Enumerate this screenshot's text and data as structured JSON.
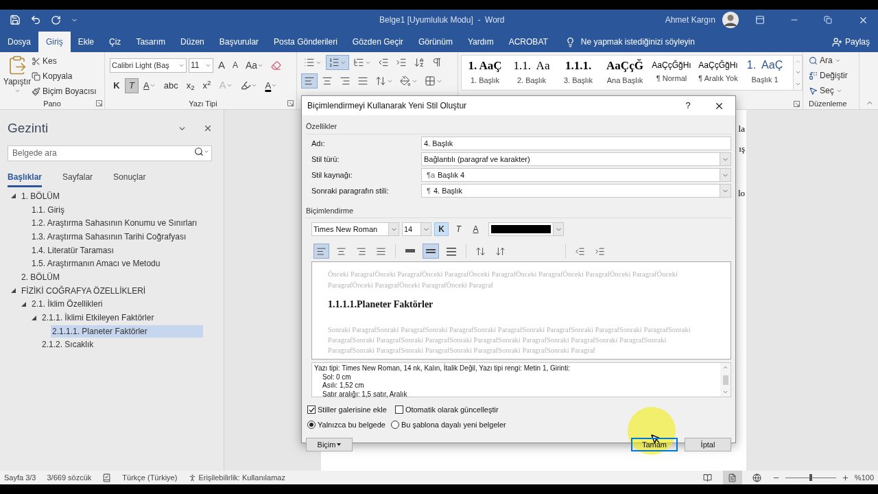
{
  "window": {
    "title": "Belge1 [Uyumluluk Modu]  -  Word",
    "user": "Ahmet Kargın"
  },
  "menu_tabs": [
    {
      "label": "Dosya",
      "selected": false
    },
    {
      "label": "Giriş",
      "selected": true
    },
    {
      "label": "Ekle",
      "selected": false
    },
    {
      "label": "Çiz",
      "selected": false
    },
    {
      "label": "Tasarım",
      "selected": false
    },
    {
      "label": "Düzen",
      "selected": false
    },
    {
      "label": "Başvurular",
      "selected": false
    },
    {
      "label": "Posta Gönderileri",
      "selected": false
    },
    {
      "label": "Gözden Geçir",
      "selected": false
    },
    {
      "label": "Görünüm",
      "selected": false
    },
    {
      "label": "Yardım",
      "selected": false
    },
    {
      "label": "ACROBAT",
      "selected": false
    }
  ],
  "tell_me": "Ne yapmak istediğinizi söyleyin",
  "share": "Paylaş",
  "ribbon": {
    "clipboard": {
      "paste": "Yapıştır",
      "items": [
        {
          "kind": "cut",
          "label": "Kes"
        },
        {
          "kind": "copy",
          "label": "Kopyala"
        },
        {
          "kind": "painter",
          "label": "Biçim Boyacısı"
        }
      ],
      "label": "Pano"
    },
    "font": {
      "font_name": "Calibri Light (Baş",
      "size": "11",
      "label": "Yazı Tipi",
      "row1_buttons": [
        {
          "kind": "grow",
          "label": "A"
        },
        {
          "kind": "shrink",
          "label": "A"
        },
        {
          "kind": "case",
          "label": "Aa"
        }
      ],
      "row2_buttons": [
        {
          "kind": "bold",
          "label": "K",
          "selected": false
        },
        {
          "kind": "italic",
          "label": "T",
          "selected": true
        },
        {
          "kind": "underline",
          "label": "A",
          "selected": false
        },
        {
          "kind": "strike",
          "label": "abc",
          "selected": false
        },
        {
          "kind": "sub",
          "label": "x$_{2}$",
          "selected": false
        },
        {
          "kind": "sup",
          "label": "x$^{2}$",
          "selected": false
        },
        {
          "kind": "effects",
          "label": "A",
          "selected": false
        },
        {
          "kind": "highlight",
          "selected": false
        },
        {
          "kind": "font_color",
          "label": "A",
          "selected": false
        }
      ]
    },
    "paragraph": {
      "row1": [
        {
          "kind": "bullets",
          "selected": false
        },
        {
          "kind": "numbering",
          "selected": true
        },
        {
          "kind": "multilevel",
          "selected": false
        },
        {
          "kind": "indent_decrease",
          "selected": false
        },
        {
          "kind": "indent_increase",
          "selected": false
        },
        {
          "kind": "sort",
          "selected": false
        },
        {
          "kind": "show_marks",
          "selected": false
        }
      ],
      "row2": [
        {
          "kind": "align_left",
          "selected": true
        },
        {
          "kind": "align_center",
          "selected": false
        },
        {
          "kind": "align_right",
          "selected": false
        },
        {
          "kind": "justify",
          "selected": false
        },
        {
          "kind": "line_spacing",
          "selected": false
        },
        {
          "kind": "shading",
          "selected": false
        },
        {
          "kind": "borders",
          "selected": false
        }
      ]
    },
    "styles": [
      {
        "preview": "1. AaÇ",
        "name": "1. Başlık",
        "kind": "serif_bold"
      },
      {
        "preview": "1.1.  Aa",
        "name": "2. Başlık",
        "kind": "serif"
      },
      {
        "preview": "1.1.1.",
        "name": "3. Başlık",
        "kind": "serif_bold"
      },
      {
        "preview": "AaÇçĞ",
        "name": "Ana Başlık",
        "kind": "serif_bold"
      },
      {
        "preview": "AaÇçĞğHı",
        "name": "¶ Normal",
        "kind": "sans"
      },
      {
        "preview": "AaÇçĞğHı",
        "name": "¶ Aralık Yok",
        "kind": "sans"
      },
      {
        "preview": "1.  AaÇ",
        "name": "Başlık 1",
        "kind": "heading_blue"
      }
    ],
    "editing": {
      "items": [
        {
          "kind": "find",
          "label": "Ara"
        },
        {
          "kind": "replace",
          "label": "Değiştir"
        },
        {
          "kind": "select",
          "label": "Seç"
        }
      ],
      "label": "Düzenleme"
    }
  },
  "navigation": {
    "title": "Gezinti",
    "search_placeholder": "Belgede ara",
    "tabs": [
      {
        "label": "Başlıklar",
        "selected": true
      },
      {
        "label": "Sayfalar",
        "selected": false
      },
      {
        "label": "Sonuçlar",
        "selected": false
      }
    ],
    "tree": [
      {
        "label": "1. BÖLÜM",
        "expanded": true,
        "selected": false,
        "children": [
          {
            "label": "1.1. Giriş",
            "selected": false
          },
          {
            "label": "1.2. Araştırma Sahasının Konumu ve Sınırları",
            "selected": false
          },
          {
            "label": "1.3. Araştırma Sahasının Tarihi Coğrafyası",
            "selected": false
          },
          {
            "label": "1.4. Literatür Taraması",
            "selected": false
          },
          {
            "label": "1.5. Araştırmanın Amacı ve Metodu",
            "selected": false
          }
        ]
      },
      {
        "label": "2. BÖLÜM",
        "selected": false
      },
      {
        "label": "FİZİKİ COĞRAFYA ÖZELLİKLERİ",
        "expanded": true,
        "selected": false,
        "children": [
          {
            "label": "2.1. İklim Özellikleri",
            "expanded": true,
            "selected": false,
            "children": [
              {
                "label": "2.1.1. İklimi Etkileyen Faktörler",
                "expanded": true,
                "selected": false,
                "children": [
                  {
                    "label": "2.1.1.1. Planeter Faktörler",
                    "selected": true
                  }
                ]
              },
              {
                "label": "2.1.2. Sıcaklık",
                "selected": false
              }
            ]
          }
        ]
      }
    ]
  },
  "document": {
    "fragments": [
      "la",
      "ış",
      "lo"
    ]
  },
  "dialog": {
    "title": "Biçimlendirmeyi Kullanarak Yeni Stil Oluştur",
    "help": "?",
    "properties_label": "Özellikler",
    "fields": [
      {
        "label": "Adı:",
        "value": "4. Başlık",
        "kind": "text"
      },
      {
        "label": "Stil türü:",
        "value": "Bağlantılı (paragraf ve karakter)",
        "kind": "dropdown"
      },
      {
        "label": "Stil kaynağı:",
        "prefix": "¶a",
        "value": "Başlık 4",
        "kind": "dropdown"
      },
      {
        "label": "Sonraki paragrafın stili:",
        "prefix": "¶",
        "value": "4. Başlık",
        "kind": "dropdown"
      }
    ],
    "formatting_label": "Biçimlendirme",
    "font_name": "Times New Roman",
    "font_size": "14",
    "format_buttons": [
      {
        "kind": "bold",
        "label": "K",
        "selected": true
      },
      {
        "kind": "italic",
        "label": "T",
        "selected": false
      },
      {
        "kind": "underline",
        "label": "A",
        "selected": false
      }
    ],
    "paragraph_button_groups": [
      [
        {
          "kind": "align_left",
          "selected": true
        },
        {
          "kind": "align_center",
          "selected": false
        },
        {
          "kind": "align_right",
          "selected": false
        },
        {
          "kind": "justify",
          "selected": false
        }
      ],
      [
        {
          "kind": "spacing_single",
          "selected": false
        },
        {
          "kind": "spacing_1_5",
          "selected": true
        },
        {
          "kind": "spacing_double",
          "selected": false
        }
      ],
      [
        {
          "kind": "space_more",
          "selected": false
        },
        {
          "kind": "space_less",
          "selected": false
        }
      ],
      [
        {
          "kind": "indent_decrease",
          "selected": false
        },
        {
          "kind": "indent_increase",
          "selected": false
        }
      ]
    ],
    "preview": {
      "previous": "Önceki ParagrafÖnceki ParagrafÖnceki ParagrafÖnceki ParagrafÖnceki ParagrafÖnceki ParagrafÖnceki ParagrafÖnceki ParagrafÖnceki ParagrafÖnceki ParagrafÖnceki Paragraf",
      "heading": "1.1.1.1.Planeter Faktörler",
      "next": "Sonraki ParagrafSonraki ParagrafSonraki ParagrafSonraki ParagrafSonraki ParagrafSonraki ParagrafSonraki ParagrafSonraki ParagrafSonraki ParagrafSonraki ParagrafSonraki ParagrafSonraki ParagrafSonraki ParagrafSonraki ParagrafSonraki ParagrafSonraki ParagrafSonraki ParagrafSonraki ParagrafSonraki ParagrafSonraki Paragraf"
    },
    "description": [
      "Yazı tipi: Times New Roman, 14 nk, Kalın, İtalik Değil, Yazı tipi rengi: Metin 1, Girinti:",
      "Sol:  0 cm",
      "Asılı:  1,52 cm",
      "Satır aralığı:  1,5 satır, Aralık"
    ],
    "checkboxes": [
      {
        "label": "Stiller galerisine ekle",
        "checked": true
      },
      {
        "label": "Otomatik olarak güncelleştir",
        "checked": false
      }
    ],
    "radios": [
      {
        "label": "Yalnızca bu belgede",
        "selected": true
      },
      {
        "label": "Bu şablona dayalı yeni belgeler",
        "selected": false
      }
    ],
    "format_menu": "Biçim",
    "buttons": [
      {
        "label": "Tamam",
        "kind": "default"
      },
      {
        "label": "İptal",
        "kind": "normal"
      }
    ]
  },
  "status_bar": {
    "page": "Sayfa 3/3",
    "words": "3/669 sözcük",
    "language": "Türkçe (Türkiye)",
    "accessibility": "Erişilebilirlik: Kullanılamaz",
    "views": [
      {
        "kind": "read",
        "selected": false
      },
      {
        "kind": "print",
        "selected": true
      },
      {
        "kind": "web",
        "selected": false
      }
    ],
    "zoom": {
      "level": 0.5,
      "reading": "%100"
    }
  }
}
